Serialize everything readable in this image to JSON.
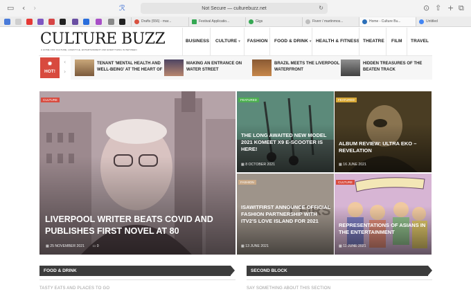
{
  "browser": {
    "url": "Not Secure — culturebuzz.net",
    "tabs": [
      {
        "label": "Drafts (556) - mar...",
        "color": "#d85140"
      },
      {
        "label": "Festival Applicatio...",
        "color": "#35a853"
      },
      {
        "label": "Gigs",
        "color": "#35a853"
      },
      {
        "label": "Fiverr / martinmos...",
        "color": "#2e2e2e"
      },
      {
        "label": "Home - Culture Bu...",
        "color": "#2b6fb8"
      },
      {
        "label": "Untitled",
        "color": "#4285f4"
      }
    ]
  },
  "site": {
    "logo": "CULTURE BUZZ",
    "tagline": "A HOME FOR CULTURE, LIFESTYLE, ENTERTAINMENT AND EVERYTHING IN BETWEEN",
    "nav": [
      {
        "label": "BUSINESS",
        "caret": ""
      },
      {
        "label": "CULTURE",
        "caret": "▾"
      },
      {
        "label": "FASHION",
        "caret": ""
      },
      {
        "label": "FOOD & DRINK",
        "caret": "▾"
      },
      {
        "label": "HEALTH & FITNESS",
        "caret": ""
      },
      {
        "label": "THEATRE",
        "caret": ""
      },
      {
        "label": "FILM",
        "caret": ""
      },
      {
        "label": "TRAVEL",
        "caret": ""
      }
    ]
  },
  "hot": {
    "badge": "HOT!",
    "items": [
      "TENANT 'MENTAL HEALTH AND WELL-BEING' AT THE HEART OF LIVERPOOL PROSPECT'S 'THE",
      "MAKING AN ENTRANCE ON WATER STREET",
      "BRAZIL MEETS THE LIVERPOOL WATERFRONT",
      "HIDDEN TREASURES OF THE BEATEN TRACK"
    ]
  },
  "featured": {
    "big": {
      "category": "CULTURE",
      "category_color": "#d84a3e",
      "title": "LIVERPOOL WRITER BEATS COVID AND PUBLISHES FIRST NOVEL AT 80",
      "date": "25 NOVEMBER 2021",
      "comments": "0"
    },
    "cards": [
      {
        "category": "FEATURED",
        "category_color": "#4caf50",
        "title": "THE LONG AWAITED NEW MODEL 2021 KOMEET X9 E-SCOOTER IS HERE!",
        "date": "8 OCTOBER 2021"
      },
      {
        "category": "FEATURED",
        "category_color": "#d9a936",
        "title": "ALBUM REVIEW: ULTRA EKO – REVELATION",
        "date": "16 JUNE 2021"
      },
      {
        "category": "FASHION",
        "category_color": "#c8a886",
        "title": "ISAWITFIRST ANNOUNCE OFFICIAL FASHION PARTNERSHIP WITH ITV2'S LOVE ISLAND FOR 2021",
        "date": "13 JUNE 2021"
      },
      {
        "category": "CULTURE",
        "category_color": "#d84a3e",
        "title": "REPRESENTATIONS OF ASIANS IN THE ENTERTAINMENT",
        "date": "11 JUNE 2021"
      }
    ]
  },
  "sections": [
    {
      "title": "FOOD & DRINK",
      "subtitle": "TASTY EATS AND PLACES TO GO"
    },
    {
      "title": "SECOND BLOCK",
      "subtitle": "SAY SOMETHING ABOUT THIS SECTION"
    }
  ],
  "icons": [
    "sidebar-icon",
    "back-icon",
    "forward-icon",
    "shield-icon",
    "refresh-icon",
    "download-icon",
    "share-icon",
    "new-tab-icon",
    "tabs-overview-icon",
    "flame-icon",
    "calendar-icon",
    "comment-icon"
  ]
}
